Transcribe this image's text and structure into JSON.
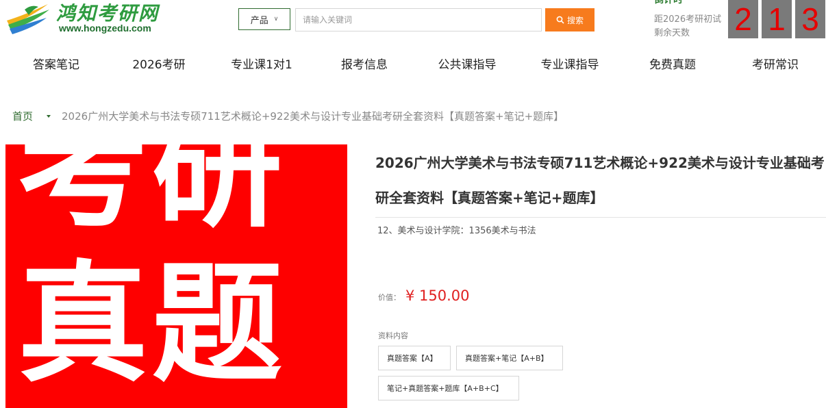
{
  "header": {
    "logo_title": "鸿知考研网",
    "logo_url": "www.hongzedu.com",
    "product_select": {
      "selected": "产品"
    },
    "search": {
      "placeholder": "请输入关键词",
      "button_label": "搜索"
    },
    "countdown": {
      "title": "倒计时",
      "line1": "距2026考研初试",
      "line2": "剩余天数",
      "digits": [
        "2",
        "1",
        "3"
      ]
    }
  },
  "nav": {
    "items": [
      {
        "label": "答案笔记"
      },
      {
        "label": "2026考研"
      },
      {
        "label": "专业课1对1"
      },
      {
        "label": "报考信息"
      },
      {
        "label": "公共课指导"
      },
      {
        "label": "专业课指导"
      },
      {
        "label": "免费真题"
      },
      {
        "label": "考研常识"
      }
    ]
  },
  "breadcrumb": {
    "home": "首页",
    "current": "2026广州大学美术与书法专硕711艺术概论+922美术与设计专业基础考研全套资料【真题答案+笔记+题库】"
  },
  "product": {
    "image_text": {
      "line1": "考研",
      "line2": "真题"
    },
    "title": "2026广州大学美术与书法专硕711艺术概论+922美术与设计专业基础考研全套资料【真题答案+笔记+题库】",
    "subtitle": "12、美术与设计学院：1356美术与书法",
    "price_label": "价值：",
    "price": "¥ 150.00",
    "content_label": "资料内容",
    "options": [
      {
        "label": "真题答案【A】"
      },
      {
        "label": "真题答案+笔记【A+B】"
      },
      {
        "label": "笔记+真题答案+题库【A+B+C】"
      }
    ]
  },
  "colors": {
    "brand_green": "#2e9b3f",
    "search_orange": "#f77b1d",
    "price_red": "#e02020",
    "hero_red": "#fe0000",
    "digit_bg": "#7a7a7a"
  }
}
